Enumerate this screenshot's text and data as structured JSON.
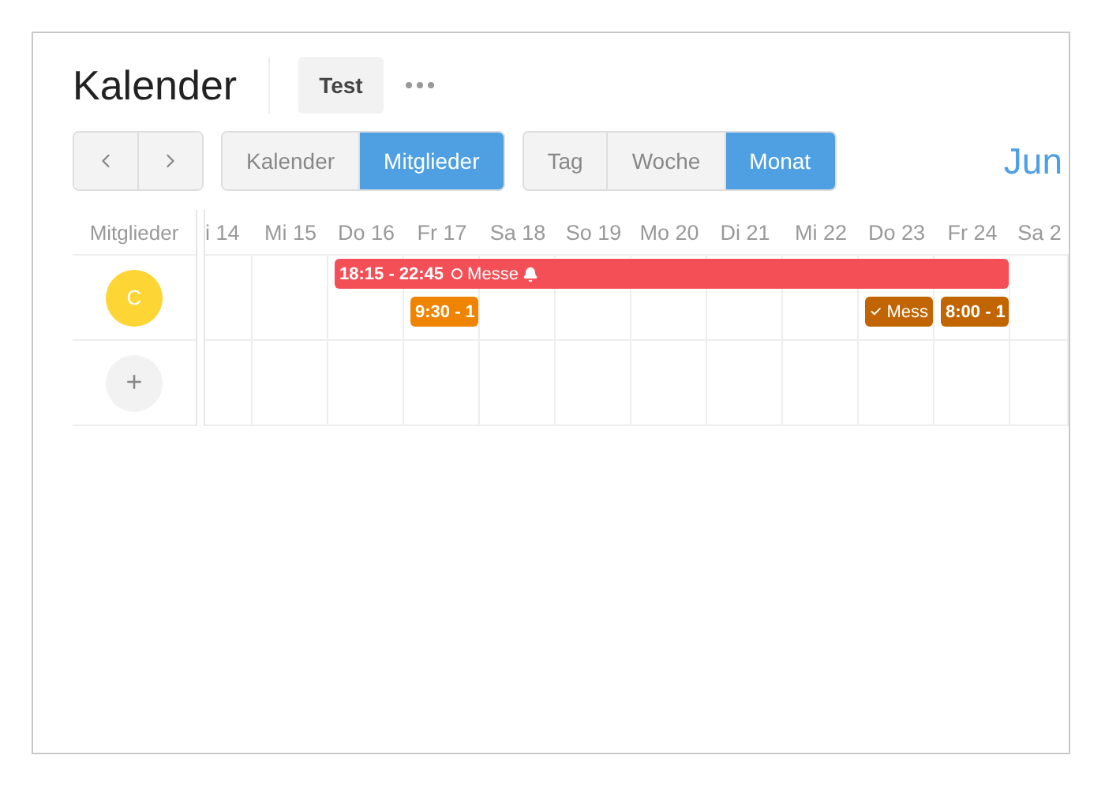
{
  "title": "Kalender",
  "tabs": [
    {
      "label": "Test",
      "selected": true
    }
  ],
  "view_toggle": [
    {
      "label": "Kalender",
      "selected": false
    },
    {
      "label": "Mitglieder",
      "selected": true
    }
  ],
  "range_toggle": [
    {
      "label": "Tag",
      "selected": false
    },
    {
      "label": "Woche",
      "selected": false
    },
    {
      "label": "Monat",
      "selected": true
    }
  ],
  "period": "Jun",
  "members_header": "Mitglieder",
  "days": [
    "i 14",
    "Mi 15",
    "Do 16",
    "Fr 17",
    "Sa 18",
    "So 19",
    "Mo 20",
    "Di 21",
    "Mi 22",
    "Do 23",
    "Fr 24",
    "Sa 2"
  ],
  "members": [
    {
      "initial": "C",
      "color": "#fdd535",
      "lanes": [
        [
          {
            "kind": "empty"
          },
          {
            "kind": "empty"
          },
          {
            "kind": "start",
            "time": "18:15 - 22:45",
            "done": false,
            "title": "Messe",
            "reminder": true,
            "color": "#f44f57"
          },
          {
            "kind": "continue"
          },
          {
            "kind": "continue"
          },
          {
            "kind": "continue"
          },
          {
            "kind": "continue"
          },
          {
            "kind": "continue"
          },
          {
            "kind": "continue"
          },
          {
            "kind": "continue"
          },
          {
            "kind": "continue"
          },
          {
            "kind": "empty"
          }
        ],
        [
          {
            "kind": "empty"
          },
          {
            "kind": "empty"
          },
          {
            "kind": "empty"
          },
          {
            "kind": "start",
            "time": "9:30 - 1",
            "color": "#ee8400"
          },
          {
            "kind": "empty"
          },
          {
            "kind": "empty"
          },
          {
            "kind": "empty"
          },
          {
            "kind": "empty"
          },
          {
            "kind": "empty"
          },
          {
            "kind": "start",
            "done": true,
            "title": "Mess",
            "color": "#c16503"
          },
          {
            "kind": "start",
            "time": "8:00 - 1",
            "color": "#c16503"
          },
          {
            "kind": "empty"
          }
        ]
      ]
    }
  ],
  "add_member": "+"
}
